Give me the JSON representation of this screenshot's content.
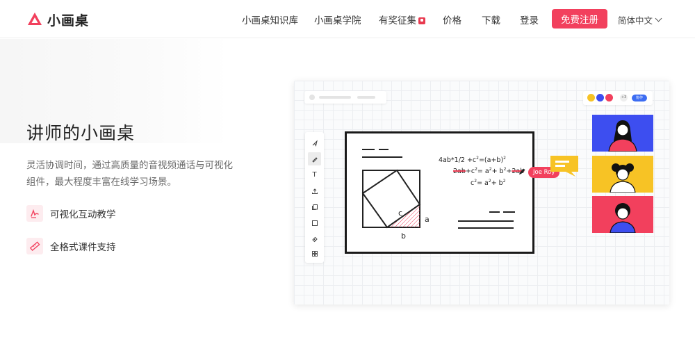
{
  "brand": {
    "name": "小画桌",
    "accent": "#f2405d",
    "logo_icon": "triangle-logo"
  },
  "nav": {
    "links": [
      {
        "label": "小画桌知识库"
      },
      {
        "label": "小画桌学院"
      },
      {
        "label": "有奖征集",
        "badge_icon": "gift-badge-icon"
      },
      {
        "label": "价格"
      },
      {
        "label": "下载"
      },
      {
        "label": "登录"
      }
    ],
    "signup_label": "免费注册",
    "language_label": "简体中文"
  },
  "hero": {
    "title": "讲师的小画桌",
    "description": "灵活协调时间，通过高质量的音视频通话与可视化组件，最大程度丰富在线学习场景。",
    "features": [
      {
        "label": "可视化互动教学",
        "icon": "handwriting-icon"
      },
      {
        "label": "全格式课件支持",
        "icon": "ruler-icon"
      }
    ]
  },
  "demo": {
    "equations": {
      "line1": "4ab*1/2 +c",
      "line1_tail": "=(a+b)",
      "line2_struck": "2ab",
      "line2_mid": "+c",
      "line2_eq": "= a",
      "line2_plus": "+ b",
      "line2_plus2": "+",
      "line2_struck2": "2ab",
      "line3": "c",
      "line3_eq": "= a",
      "line3_plus": "+ b",
      "sup2": "2"
    },
    "labels": {
      "a": "a",
      "b": "b",
      "c": "c"
    },
    "cursor_name": "Joe Roy",
    "toolbar_tools": [
      "pointer-icon",
      "pen-icon",
      "text-icon",
      "upload-icon",
      "copy-icon",
      "rectangle-icon",
      "eraser-icon",
      "grid-icon"
    ],
    "tool_text_glyph": "T",
    "collab_plus": "+3",
    "collab_button": "协作",
    "video_colors": [
      "#3d4ef0",
      "#f7c325",
      "#f2405d"
    ]
  }
}
